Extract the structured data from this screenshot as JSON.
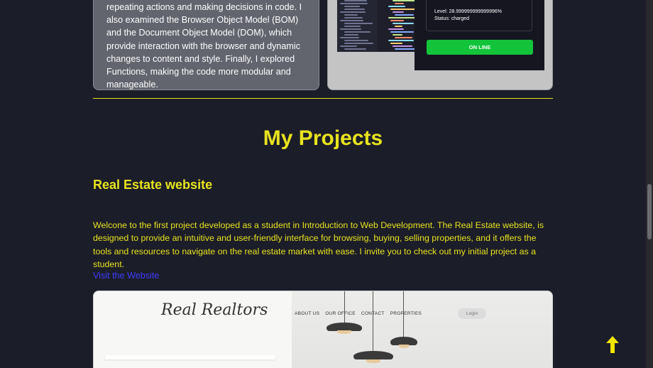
{
  "previous_section": {
    "description": "repeating actions and making decisions in code. I also examined the Browser Object Model (BOM) and the Document Object Model (DOM), which provide interaction with the browser and dynamic changes to content and style. Finally, I explored Functions, making the code more modular and manageable.",
    "phone": {
      "level_text": "Level: 28.999999999999996%",
      "status_text": "Status: charged",
      "online_button": "ON LINE"
    }
  },
  "projects": {
    "section_title": "My Projects",
    "items": [
      {
        "title": "Real Estate website",
        "description": "Welcone to the first project developed as a student in Introduction to Web Development. The Real Estate website, is designed to provide an intuitive and user-friendly interface for browsing, buying, selling properties, and it offers the tools and resources to navigate on the real estate market with ease. I invite you to check out my initial project as a student.",
        "link_text": "Visit the Website",
        "preview": {
          "logo": "Real Realtors",
          "nav": [
            "ABOUT US",
            "OUR OFFICE",
            "CONTACT",
            "PROPERTIES"
          ],
          "login": "Login"
        }
      }
    ]
  },
  "colors": {
    "background": "#1b1d29",
    "accent": "#e8e31e",
    "link": "#3d3dff",
    "online": "#13c43a"
  },
  "icons": {
    "scroll_top": "arrow-up-icon"
  }
}
